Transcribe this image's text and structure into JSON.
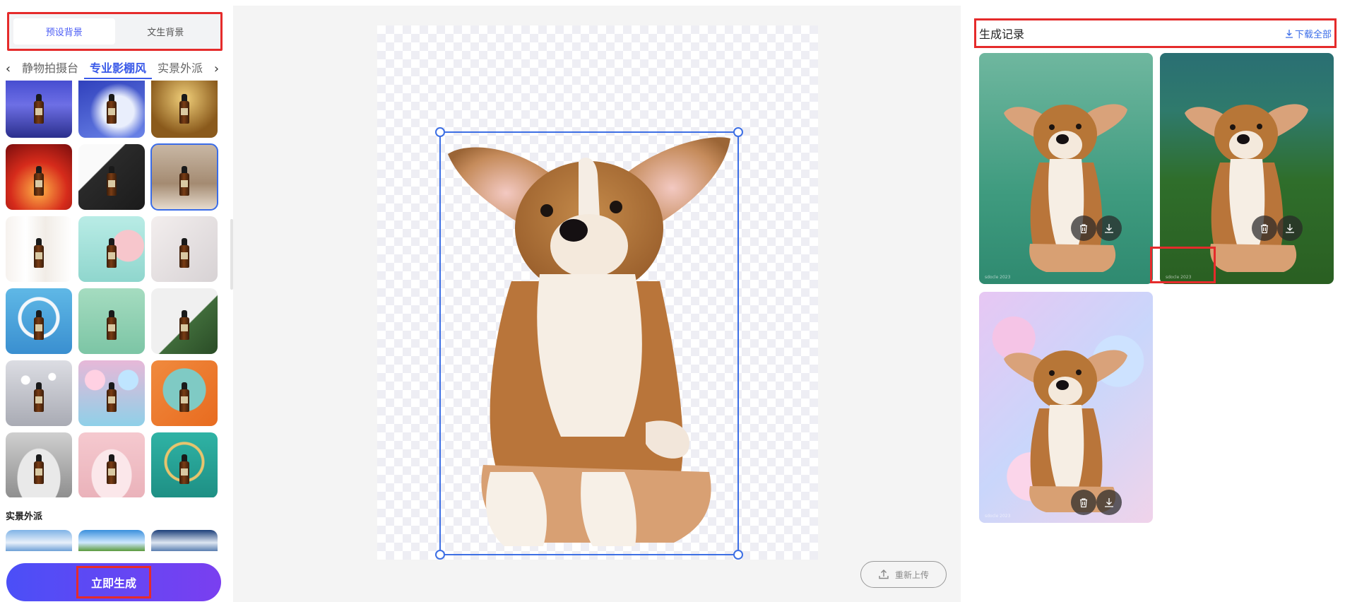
{
  "left": {
    "tabs": [
      {
        "label": "预设背景",
        "active": true
      },
      {
        "label": "文生背景",
        "active": false
      }
    ],
    "categories": [
      "静物拍摄台",
      "专业影棚风",
      "实景外派"
    ],
    "active_category": "专业影棚风",
    "section_title": "实景外派",
    "generate_label": "立即生成"
  },
  "center": {
    "reupload_label": "重新上传"
  },
  "right": {
    "title": "生成记录",
    "download_all": "下载全部",
    "watermark": "sdocle 2023"
  },
  "colors": {
    "accent": "#3a5ae8",
    "highlight": "#e52b2b",
    "button_gradient": [
      "#4b4ff7",
      "#7a3ff0"
    ]
  }
}
